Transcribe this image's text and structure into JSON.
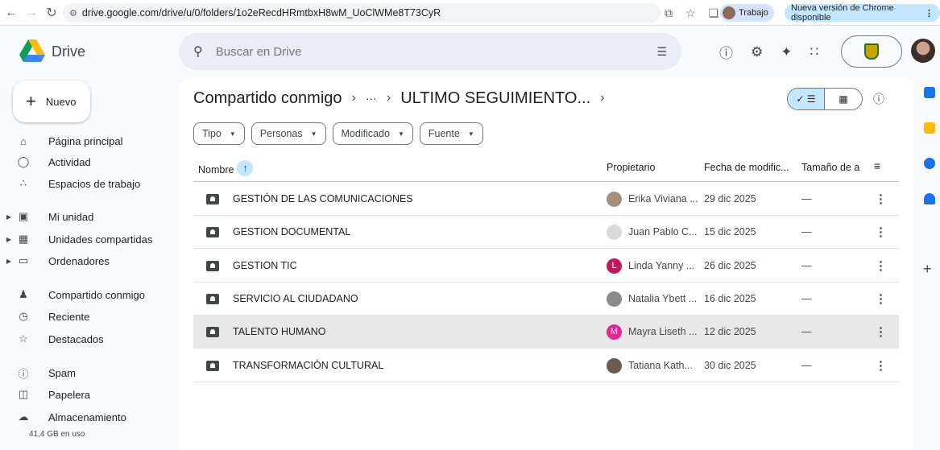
{
  "browser": {
    "url": "drive.google.com/drive/u/0/folders/1o2eRecdHRmtbxH8wM_UoClWMe8T73CyR",
    "profile_label": "Trabajo",
    "update_label": "Nueva versión de Chrome disponible"
  },
  "app": {
    "name": "Drive",
    "search_placeholder": "Buscar en Drive"
  },
  "sidebar": {
    "new_label": "Nuevo",
    "items": [
      {
        "label": "Página principal",
        "icon": "home-icon"
      },
      {
        "label": "Actividad",
        "icon": "bell-icon"
      },
      {
        "label": "Espacios de trabajo",
        "icon": "workspaces-icon"
      },
      {
        "label": "Mi unidad",
        "icon": "my-drive-icon"
      },
      {
        "label": "Unidades compartidas",
        "icon": "shared-drives-icon"
      },
      {
        "label": "Ordenadores",
        "icon": "computer-icon"
      },
      {
        "label": "Compartido conmigo",
        "icon": "people-icon"
      },
      {
        "label": "Reciente",
        "icon": "clock-icon"
      },
      {
        "label": "Destacados",
        "icon": "star-icon"
      },
      {
        "label": "Spam",
        "icon": "spam-icon"
      },
      {
        "label": "Papelera",
        "icon": "trash-icon"
      },
      {
        "label": "Almacenamiento",
        "icon": "cloud-icon"
      }
    ],
    "storage_used": "41,4 GB en uso"
  },
  "breadcrumb": {
    "root": "Compartido conmigo",
    "ellipsis": "···",
    "current": "ULTIMO SEGUIMIENTO..."
  },
  "filters": [
    "Tipo",
    "Personas",
    "Modificado",
    "Fuente"
  ],
  "table": {
    "headers": {
      "name": "Nombre",
      "owner": "Propietario",
      "modified": "Fecha de modific...",
      "size": "Tamaño de a"
    },
    "rows": [
      {
        "name": "GESTIÓN DE LAS COMUNICACIONES",
        "owner": "Erika Viviana ...",
        "owner_initial": "",
        "owner_color": "#a58f7f",
        "modified": "29 dic 2025",
        "size": "—"
      },
      {
        "name": "GESTION DOCUMENTAL",
        "owner": "Juan Pablo C...",
        "owner_initial": "",
        "owner_color": "#d9d9d9",
        "modified": "15 dic 2025",
        "size": "—"
      },
      {
        "name": "GESTION TIC",
        "owner": "Linda Yanny ...",
        "owner_initial": "L",
        "owner_color": "#c2185b",
        "modified": "26 dic 2025",
        "size": "—"
      },
      {
        "name": "SERVICIO AL CIUDADANO",
        "owner": "Natalia Ybett ...",
        "owner_initial": "",
        "owner_color": "#8a8a8a",
        "modified": "16 dic 2025",
        "size": "—"
      },
      {
        "name": "TALENTO HUMANO",
        "owner": "Mayra Liseth ...",
        "owner_initial": "M",
        "owner_color": "#e52592",
        "modified": "12 dic 2025",
        "size": "—"
      },
      {
        "name": "TRANSFORMACIÓN CULTURAL",
        "owner": "Tatiana Kath...",
        "owner_initial": "",
        "owner_color": "#6b5a4e",
        "modified": "30 dic 2025",
        "size": "—"
      }
    ],
    "selected_index": 4
  }
}
